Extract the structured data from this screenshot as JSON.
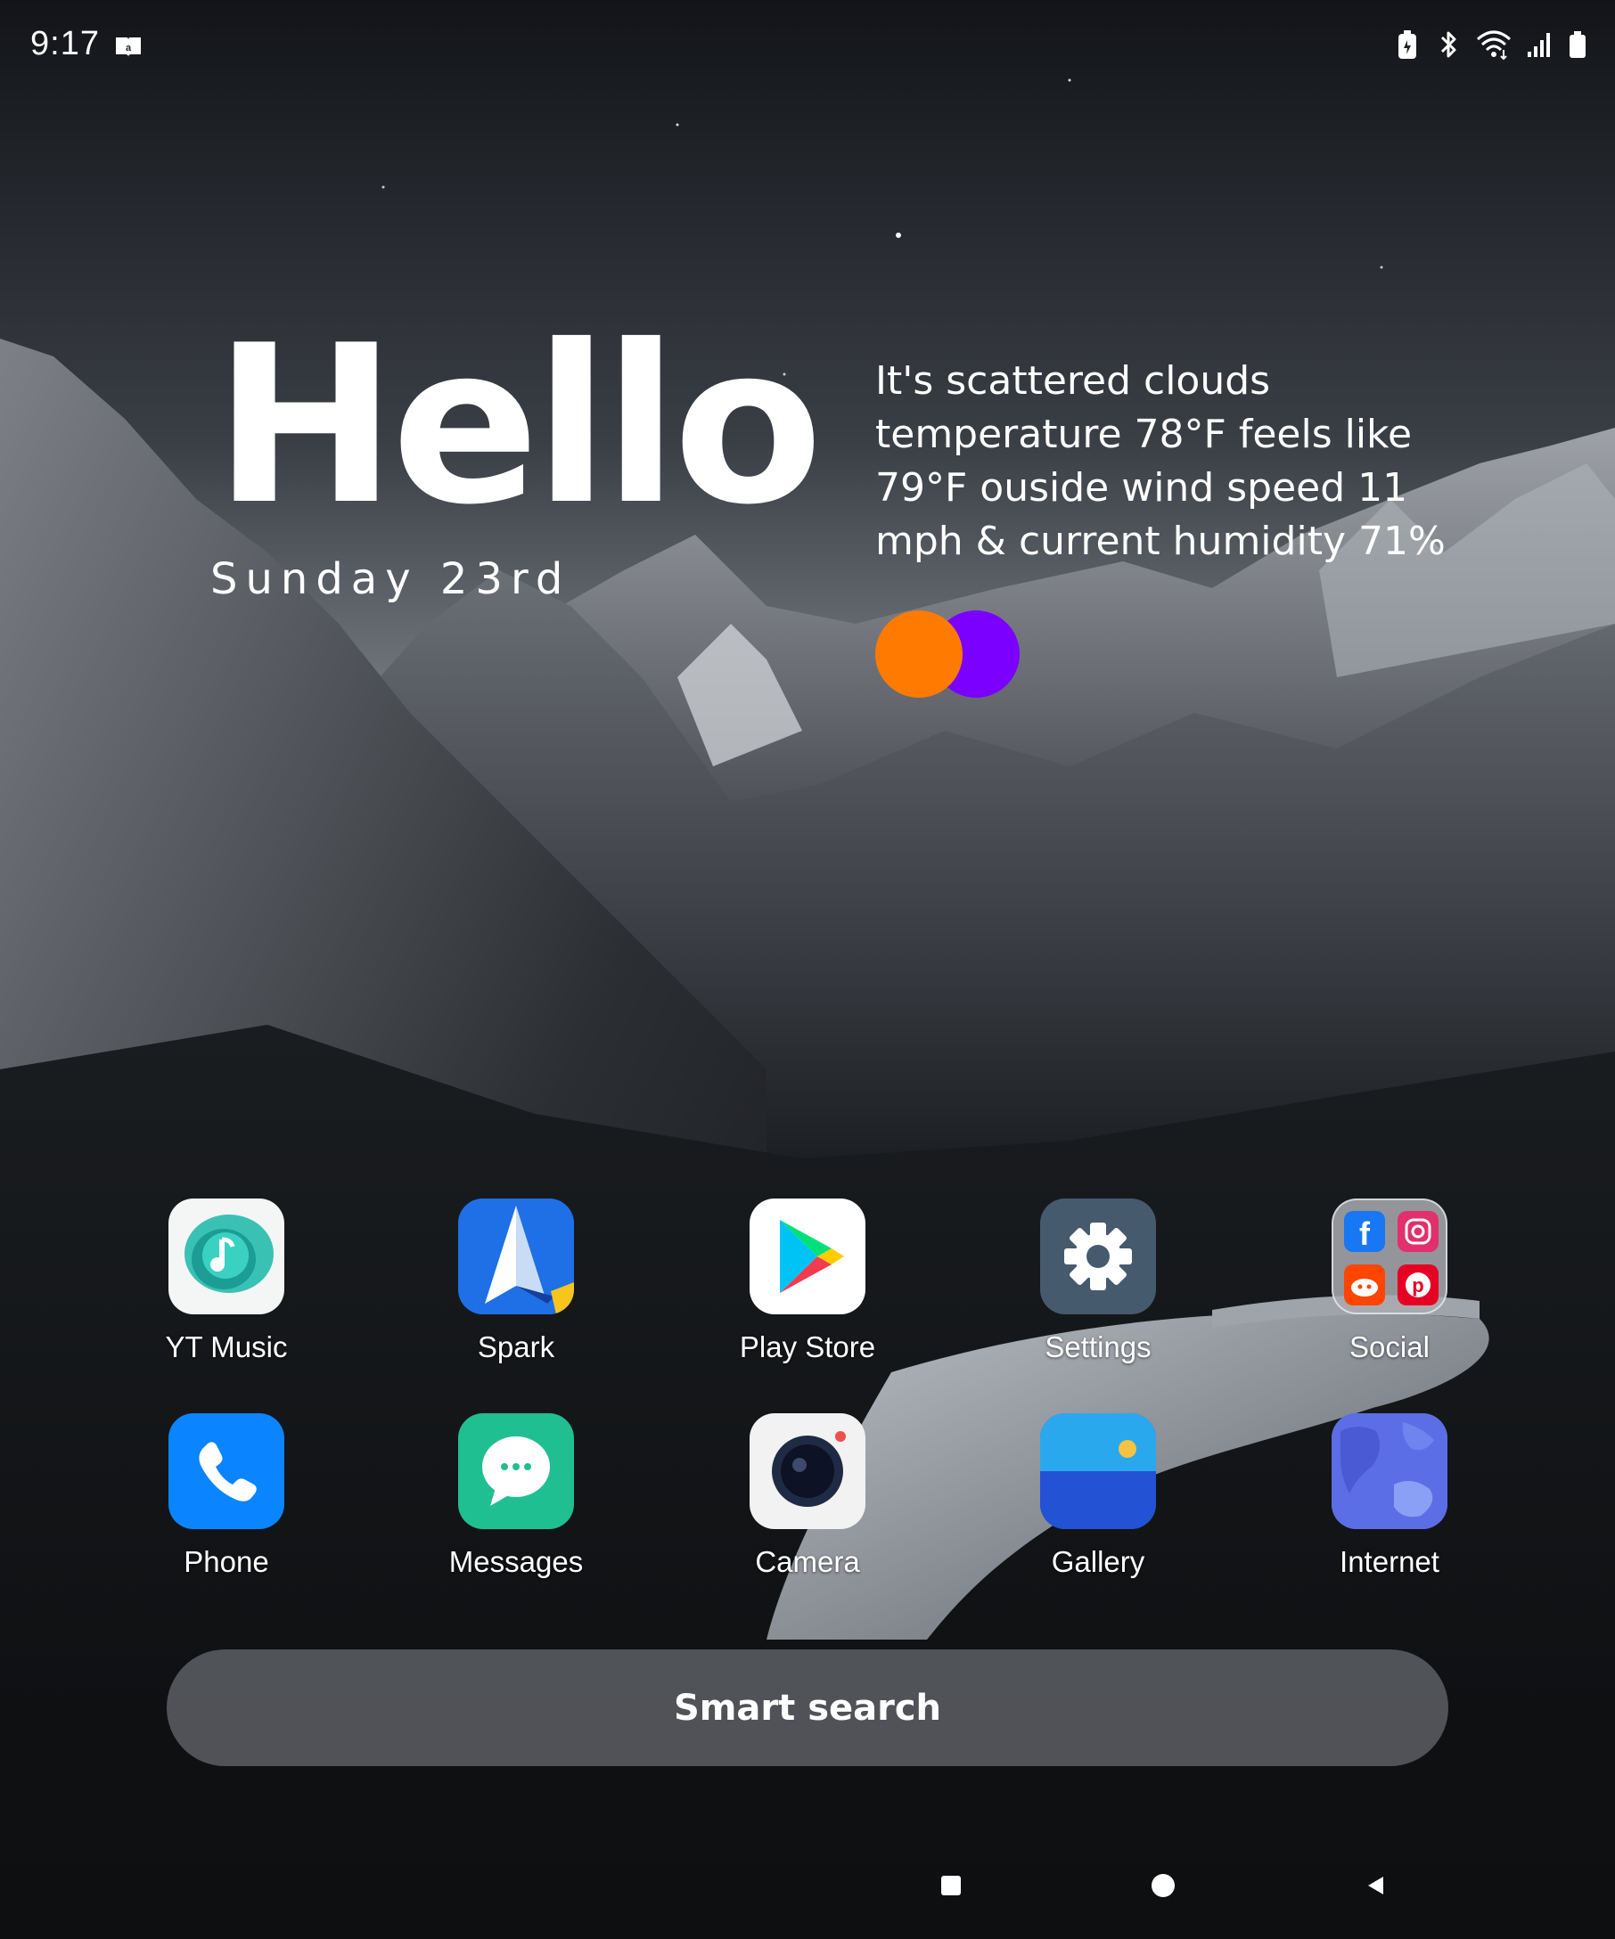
{
  "status_bar": {
    "time": "9:17",
    "notification_icons": [
      "amazon-kindle-icon"
    ],
    "system_icons": [
      "battery-saver-icon",
      "bluetooth-icon",
      "wifi-icon",
      "signal-icon",
      "battery-icon"
    ]
  },
  "widget": {
    "greeting": "Hello",
    "date": "Sunday 23rd",
    "weather": "It's scattered clouds temperature 78°F feels like 79°F ouside wind speed 11 mph & current humidity 71%",
    "dot_colors": [
      "#ff7a00",
      "#7b00ff"
    ]
  },
  "apps": [
    {
      "label": "YT Music",
      "icon": "yt-music-icon"
    },
    {
      "label": "Spark",
      "icon": "spark-icon"
    },
    {
      "label": "Play Store",
      "icon": "play-store-icon"
    },
    {
      "label": "Settings",
      "icon": "gear-icon"
    },
    {
      "label": "Social",
      "icon": "folder-icon"
    },
    {
      "label": "Phone",
      "icon": "phone-icon"
    },
    {
      "label": "Messages",
      "icon": "messages-icon"
    },
    {
      "label": "Camera",
      "icon": "camera-icon"
    },
    {
      "label": "Gallery",
      "icon": "gallery-icon"
    },
    {
      "label": "Internet",
      "icon": "internet-icon"
    }
  ],
  "search": {
    "label": "Smart search"
  },
  "navigation": {
    "buttons": [
      "recents-button",
      "home-button",
      "back-button"
    ]
  }
}
